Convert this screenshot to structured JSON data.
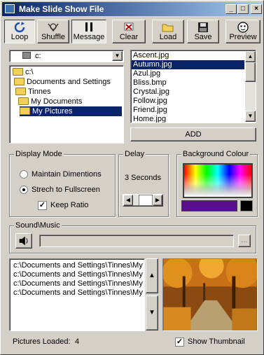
{
  "window": {
    "title": "Make Slide Show File"
  },
  "toolbar": {
    "loop": "Loop",
    "shuffle": "Shuffle",
    "message": "Message",
    "clear": "Clear",
    "load": "Load",
    "save": "Save",
    "preview": "Preview"
  },
  "drive": {
    "value": "c:"
  },
  "folders": [
    "c:\\",
    "Documents and Settings",
    "Tinnes",
    "My Documents",
    "My Pictures"
  ],
  "files": [
    "Ascent.jpg",
    "Autumn.jpg",
    "Azul.jpg",
    "Bliss.bmp",
    "Crystal.jpg",
    "Follow.jpg",
    "Friend.jpg",
    "Home.jpg"
  ],
  "add_button": "ADD",
  "display_mode": {
    "title": "Display Mode",
    "option1": "Maintain Dimentions",
    "option2": "Strech to Fullscreen",
    "keep_ratio": "Keep Ratio"
  },
  "delay": {
    "title": "Delay",
    "value": "3 Seconds"
  },
  "background": {
    "title": "Background Colour",
    "selected_color": "#5c0f8c"
  },
  "sound": {
    "title": "Sound\\Music",
    "browse": "..."
  },
  "slides": [
    "c:\\Documents and Settings\\Tinnes\\My",
    "c:\\Documents and Settings\\Tinnes\\My",
    "c:\\Documents and Settings\\Tinnes\\My",
    "c:\\Documents and Settings\\Tinnes\\My"
  ],
  "status": {
    "label": "Pictures Loaded:",
    "count": "4"
  },
  "thumbnail": {
    "label": "Show Thumbnail"
  },
  "colors": {
    "accent": "#0a246a",
    "face": "#d4d0c8"
  }
}
